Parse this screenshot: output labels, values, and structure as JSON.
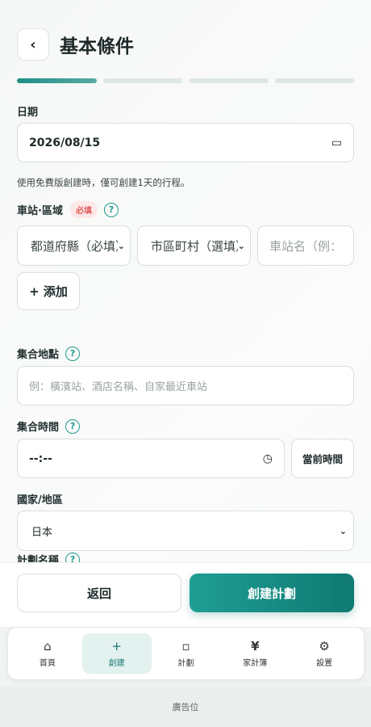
{
  "header": {
    "back_icon": "‹",
    "title": "基本條件"
  },
  "progress": {
    "steps": 4,
    "current": 1
  },
  "date": {
    "label": "日期",
    "value": "2026/08/15",
    "calendar_icon": "▭",
    "note": "使用免費版創建時，僅可創建1天的行程。"
  },
  "station": {
    "label": "車站·區域",
    "badge": "必填",
    "help": "?",
    "prefecture_placeholder": "都道府縣（必填）",
    "city_placeholder": "市區町村（選填）",
    "station_placeholder": "車站名（例：",
    "add_label": "+ 添加"
  },
  "meeting_place": {
    "label": "集合地點",
    "help": "?",
    "placeholder": "例：橫濱站、酒店名稱、自家最近車站"
  },
  "meeting_time": {
    "label": "集合時間",
    "help": "?",
    "value": "--:--",
    "clock_icon": "◷",
    "now_button": "當前時間"
  },
  "country": {
    "label": "國家/地區",
    "value": "日本"
  },
  "plan_name": {
    "label": "計劃名稱",
    "help": "?"
  },
  "actions": {
    "back": "返回",
    "create": "創建計劃"
  },
  "tabs": [
    {
      "icon": "⌂",
      "label": "首頁"
    },
    {
      "icon": "+",
      "label": "創建"
    },
    {
      "icon": "▫",
      "label": "計劃"
    },
    {
      "icon": "¥",
      "label": "家計簿"
    },
    {
      "icon": "⚙",
      "label": "設置"
    }
  ],
  "ad": "廣告位",
  "colors": {
    "accent": "#1f9a8f",
    "badge_bg": "#fde8e8",
    "badge_text": "#e05c5c"
  }
}
